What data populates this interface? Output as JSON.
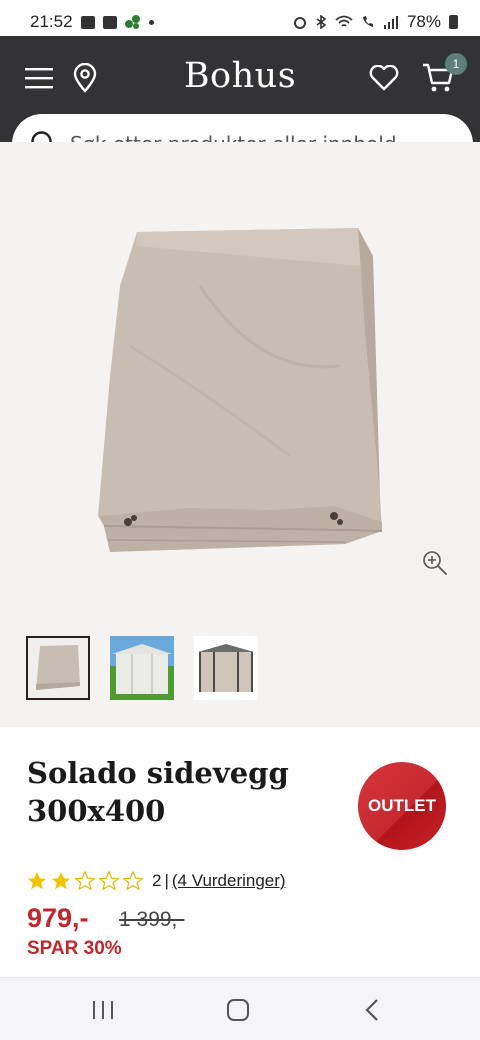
{
  "status_bar": {
    "time": "21:52",
    "battery": "78%"
  },
  "header": {
    "logo": "Bohus",
    "cart_count": "1"
  },
  "search": {
    "placeholder": "Søk etter produkter eller innhold..."
  },
  "product": {
    "title": "Solado sidevegg 300x400",
    "badge": "OUTLET",
    "rating": {
      "stars": 2,
      "max": 5,
      "count": "2",
      "separator": "|",
      "reviews_link": "(4 Vurderinger)"
    },
    "price": "979,-",
    "old_price": "1 399,-",
    "discount": "SPAR 30%"
  },
  "colors": {
    "header_bg": "#333335",
    "accent_red": "#c2272d",
    "star": "#f2c400",
    "badge_teal": "#5e7f7a"
  }
}
